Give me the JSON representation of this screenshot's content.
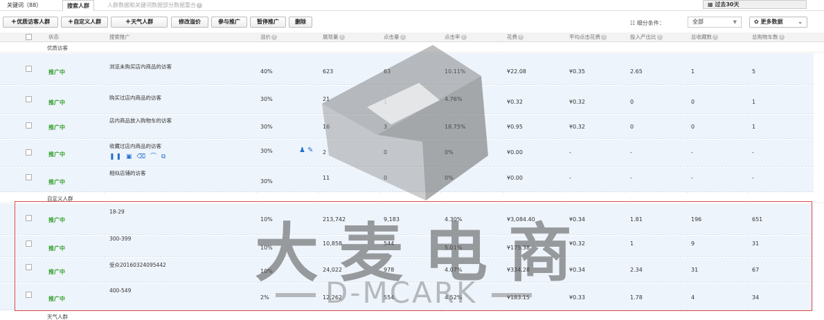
{
  "tabs": {
    "keyword": "关键词（88）",
    "crowd": "搜索人群",
    "note": "人群数据和关键词数据部分数据重合"
  },
  "date_range": "过去30天",
  "toolbar": {
    "add_visitor": "优质访客人群",
    "add_custom": "自定义人群",
    "add_weather": "天气人群",
    "modify_premium": "修改溢价",
    "join_promo": "参与推广",
    "pause_promo": "暂停推广",
    "delete": "删除",
    "filter_label": "细分条件：",
    "filter_value": "全部",
    "more_data": "更多数据"
  },
  "columns": [
    "状态",
    "搜索推广",
    "溢价",
    "展现量",
    "点击量",
    "点击率",
    "花费",
    "平均点击花费",
    "投入产出比",
    "总收藏数",
    "总购物车数"
  ],
  "groups": {
    "visitors": "优质访客",
    "custom": "自定义人群",
    "weather": "天气人群"
  },
  "rows": [
    {
      "status": "推广中",
      "name": "浏览未购买店内商品的访客",
      "premium": "40%",
      "impressions": "623",
      "clicks": "63",
      "ctr": "10.11%",
      "cost": "¥22.08",
      "cpc": "¥0.35",
      "roi": "2.65",
      "favorites": "1",
      "carts": "5"
    },
    {
      "status": "推广中",
      "name": "购买过店内商品的访客",
      "premium": "30%",
      "impressions": "21",
      "clicks": "1",
      "ctr": "4.76%",
      "cost": "¥0.32",
      "cpc": "¥0.32",
      "roi": "0",
      "favorites": "0",
      "carts": "1"
    },
    {
      "status": "推广中",
      "name": "店内商品放入购物车的访客",
      "premium": "30%",
      "impressions": "16",
      "clicks": "3",
      "ctr": "18.75%",
      "cost": "¥0.95",
      "cpc": "¥0.32",
      "roi": "0",
      "favorites": "0",
      "carts": "1"
    },
    {
      "status": "推广中",
      "name": "收藏过店内商品的访客",
      "premium": "30%",
      "impressions": "2",
      "clicks": "0",
      "ctr": "0%",
      "cost": "¥0.00",
      "cpc": "-",
      "roi": "-",
      "favorites": "-",
      "carts": "-"
    },
    {
      "status": "推广中",
      "name": "相似店铺的访客",
      "premium": "30%",
      "impressions": "11",
      "clicks": "0",
      "ctr": "0%",
      "cost": "¥0.00",
      "cpc": "-",
      "roi": "-",
      "favorites": "-",
      "carts": "-"
    },
    {
      "status": "推广中",
      "name": "18-29",
      "premium": "10%",
      "impressions": "213,742",
      "clicks": "9,183",
      "ctr": "4.30%",
      "cost": "¥3,084.40",
      "cpc": "¥0.34",
      "roi": "1.81",
      "favorites": "196",
      "carts": "651"
    },
    {
      "status": "推广中",
      "name": "300-399",
      "premium": "10%",
      "impressions": "10,858",
      "clicks": "544",
      "ctr": "5.01%",
      "cost": "¥175.38",
      "cpc": "¥0.32",
      "roi": "1",
      "favorites": "9",
      "carts": "31"
    },
    {
      "status": "推广中",
      "name": "受众20160324095442",
      "premium": "10%",
      "impressions": "24,022",
      "clicks": "978",
      "ctr": "4.07%",
      "cost": "¥334.28",
      "cpc": "¥0.34",
      "roi": "2.34",
      "favorites": "31",
      "carts": "67"
    },
    {
      "status": "推广中",
      "name": "400-549",
      "premium": "2%",
      "impressions": "12,262",
      "clicks": "554",
      "ctr": "4.52%",
      "cost": "¥183.15",
      "cpc": "¥0.33",
      "roi": "1.78",
      "favorites": "4",
      "carts": "34"
    }
  ],
  "watermark": {
    "cn": "大麦电商",
    "en": "D-MCARK"
  },
  "colors": {
    "status_green": "#33a02c",
    "row_bg": "#eef4fb",
    "highlight_border": "#e24b4b",
    "icon_blue": "#1e6fd0"
  }
}
